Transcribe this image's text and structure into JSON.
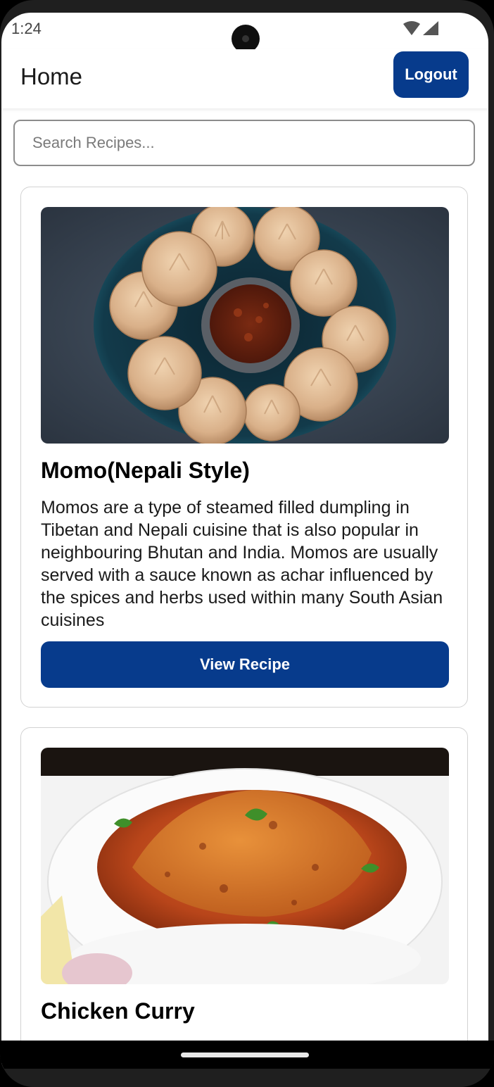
{
  "status_bar": {
    "time": "1:24",
    "icons": [
      "wifi-icon",
      "cell-signal-icon"
    ]
  },
  "header": {
    "title": "Home",
    "logout_label": "Logout"
  },
  "search": {
    "placeholder": "Search Recipes..."
  },
  "recipes": [
    {
      "title": "Momo(Nepali Style)",
      "description": "Momos are a type of steamed filled dumpling in Tibetan and Nepali cuisine that is also popular in neighbouring Bhutan and India. Momos are usually served with a sauce known as achar influenced by the spices and herbs used within many South Asian cuisines",
      "button_label": "View Recipe"
    },
    {
      "title": "Chicken Curry"
    }
  ],
  "colors": {
    "primary": "#073b8c",
    "background": "#ffffff",
    "card_border": "#d2d2d2"
  }
}
